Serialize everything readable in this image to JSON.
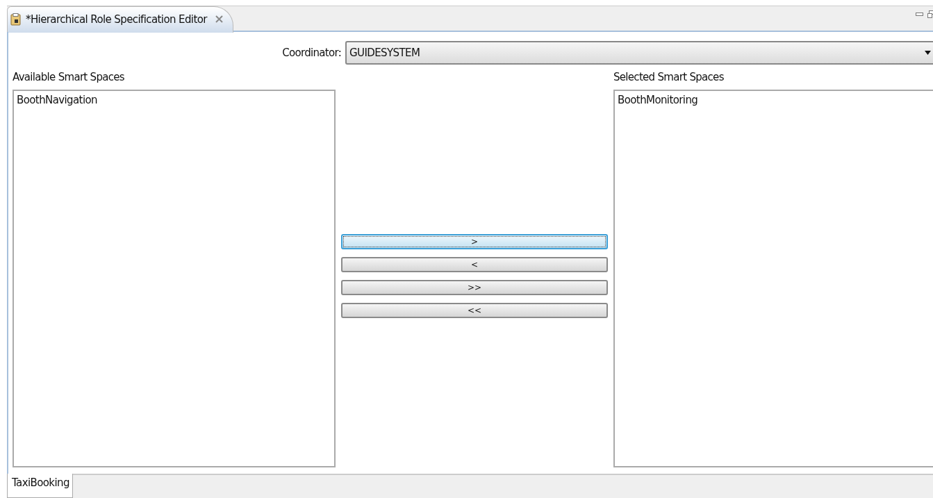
{
  "editor_tab": {
    "title": "*Hierarchical Role Specification Editor",
    "selected": true
  },
  "coordinator": {
    "label": "Coordinator:",
    "value": "GUIDESYSTEM"
  },
  "available": {
    "label": "Available Smart Spaces",
    "items": [
      "BoothNavigation"
    ]
  },
  "buttons": [
    {
      "label": ">",
      "focused": true
    },
    {
      "label": "<",
      "focused": false
    },
    {
      "label": ">>",
      "focused": false
    },
    {
      "label": "<<",
      "focused": false
    }
  ],
  "selected_spaces": {
    "label": "Selected Smart Spaces",
    "items": [
      "BoothMonitoring"
    ]
  },
  "bottom_tabs": [
    {
      "label": "TaxiBooking",
      "selected": true
    }
  ]
}
